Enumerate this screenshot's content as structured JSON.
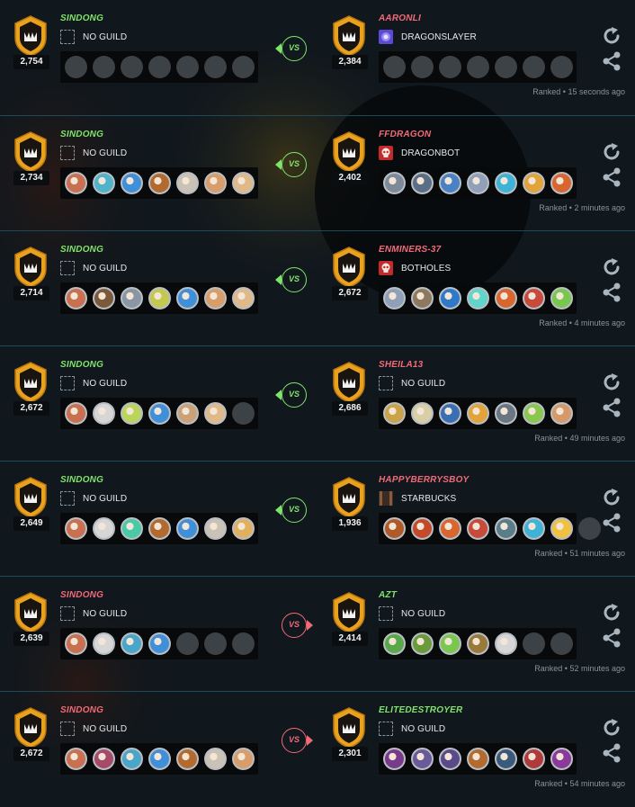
{
  "vs_label": "VS",
  "battles": [
    {
      "result": "win",
      "left": {
        "name": "SINDONG",
        "guild": "NO GUILD",
        "guild_icon": "empty-guild-icon",
        "rating": "2,754",
        "team": [
          "empty",
          "empty",
          "empty",
          "empty",
          "empty",
          "empty",
          "empty"
        ]
      },
      "right": {
        "name": "AARONLI",
        "guild": "DRAGONSLAYER",
        "guild_icon": "purple-orb-guild-icon",
        "rating": "2,384",
        "team": [
          "empty",
          "empty",
          "empty",
          "empty",
          "empty",
          "empty",
          "empty"
        ]
      },
      "time": "Ranked • 15 seconds ago"
    },
    {
      "result": "win",
      "left": {
        "name": "SINDONG",
        "guild": "NO GUILD",
        "guild_icon": "empty-guild-icon",
        "rating": "2,734",
        "team": [
          "#c8704f",
          "#4fb3c9",
          "#3f8fd9",
          "#b36a2e",
          "#c9c2b5",
          "#d79d6a",
          "#e0b98a"
        ]
      },
      "right": {
        "name": "FFDRAGON",
        "guild": "DRAGONBOT",
        "guild_icon": "red-skull-guild-icon",
        "rating": "2,402",
        "team": [
          "#7d8a9a",
          "#5a6e85",
          "#4a80c4",
          "#8fa0b8",
          "#3fb3d6",
          "#e0a43a",
          "#d9652f"
        ]
      },
      "time": "Ranked • 2 minutes ago"
    },
    {
      "result": "win",
      "left": {
        "name": "SINDONG",
        "guild": "NO GUILD",
        "guild_icon": "empty-guild-icon",
        "rating": "2,714",
        "team": [
          "#c8704f",
          "#7a5a3a",
          "#8a96a3",
          "#c3c94f",
          "#3f8fd9",
          "#d79d6a",
          "#e0b98a"
        ]
      },
      "right": {
        "name": "ENMINERS-37",
        "guild": "BOTHOLES",
        "guild_icon": "red-skull-guild-icon",
        "rating": "2,672",
        "team": [
          "#8fa0b8",
          "#8d7a5e",
          "#2f79c9",
          "#5fd6c9",
          "#d9652f",
          "#c84a3a",
          "#7ac74f"
        ]
      },
      "time": "Ranked • 4 minutes ago"
    },
    {
      "result": "win",
      "left": {
        "name": "SINDONG",
        "guild": "NO GUILD",
        "guild_icon": "empty-guild-icon",
        "rating": "2,672",
        "team": [
          "#c8704f",
          "#d6d6d6",
          "#b9d65a",
          "#3f8fd9",
          "#c9a27a",
          "#e0b98a",
          "empty"
        ]
      },
      "right": {
        "name": "SHEILA13",
        "guild": "NO GUILD",
        "guild_icon": "empty-guild-icon",
        "rating": "2,686",
        "team": [
          "#c9a24a",
          "#d8cfa6",
          "#3a6fb4",
          "#e0a43a",
          "#6a7682",
          "#8ac74f",
          "#d69a6a"
        ]
      },
      "time": "Ranked • 49 minutes ago"
    },
    {
      "result": "win",
      "left": {
        "name": "SINDONG",
        "guild": "NO GUILD",
        "guild_icon": "empty-guild-icon",
        "rating": "2,649",
        "team": [
          "#c8704f",
          "#d6d6d6",
          "#49c9a6",
          "#b36a2e",
          "#3f8fd9",
          "#c9c2b5",
          "#e0b060"
        ]
      },
      "right": {
        "name": "HAPPYBERRYSBOY",
        "guild": "STARBUCKS",
        "guild_icon": "banner-guild-icon",
        "rating": "1,936",
        "team": [
          "#b05a2a",
          "#c44a2a",
          "#d9652f",
          "#c84a3a",
          "#5a7d8a",
          "#3fb3d6",
          "#f0c040",
          "empty"
        ]
      },
      "time": "Ranked • 51 minutes ago"
    },
    {
      "result": "lose",
      "left": {
        "name": "SINDONG",
        "guild": "NO GUILD",
        "guild_icon": "empty-guild-icon",
        "rating": "2,639",
        "team": [
          "#c8704f",
          "#d6d6d6",
          "#49a6c9",
          "#3f8fd9",
          "empty",
          "empty",
          "empty"
        ]
      },
      "right": {
        "name": "AZT",
        "guild": "NO GUILD",
        "guild_icon": "empty-guild-icon",
        "rating": "2,414",
        "team": [
          "#5aa84a",
          "#6a9a3a",
          "#7ac74f",
          "#9a7a3a",
          "#d6d6d6",
          "empty",
          "empty"
        ]
      },
      "time": "Ranked • 52 minutes ago"
    },
    {
      "result": "lose",
      "left": {
        "name": "SINDONG",
        "guild": "NO GUILD",
        "guild_icon": "empty-guild-icon",
        "rating": "2,672",
        "team": [
          "#c8704f",
          "#a64a6a",
          "#49a6c9",
          "#3f8fd9",
          "#b36a2e",
          "#c9c2b5",
          "#d79d6a"
        ]
      },
      "right": {
        "name": "ELITEDESTROYER",
        "guild": "NO GUILD",
        "guild_icon": "empty-guild-icon",
        "rating": "2,301",
        "team": [
          "#7a3a8a",
          "#6a5a9a",
          "#5a4a8a",
          "#b36a2e",
          "#3a5a7a",
          "#b03a3a",
          "#8a3a9a"
        ]
      },
      "time": "Ranked • 54 minutes ago"
    }
  ]
}
